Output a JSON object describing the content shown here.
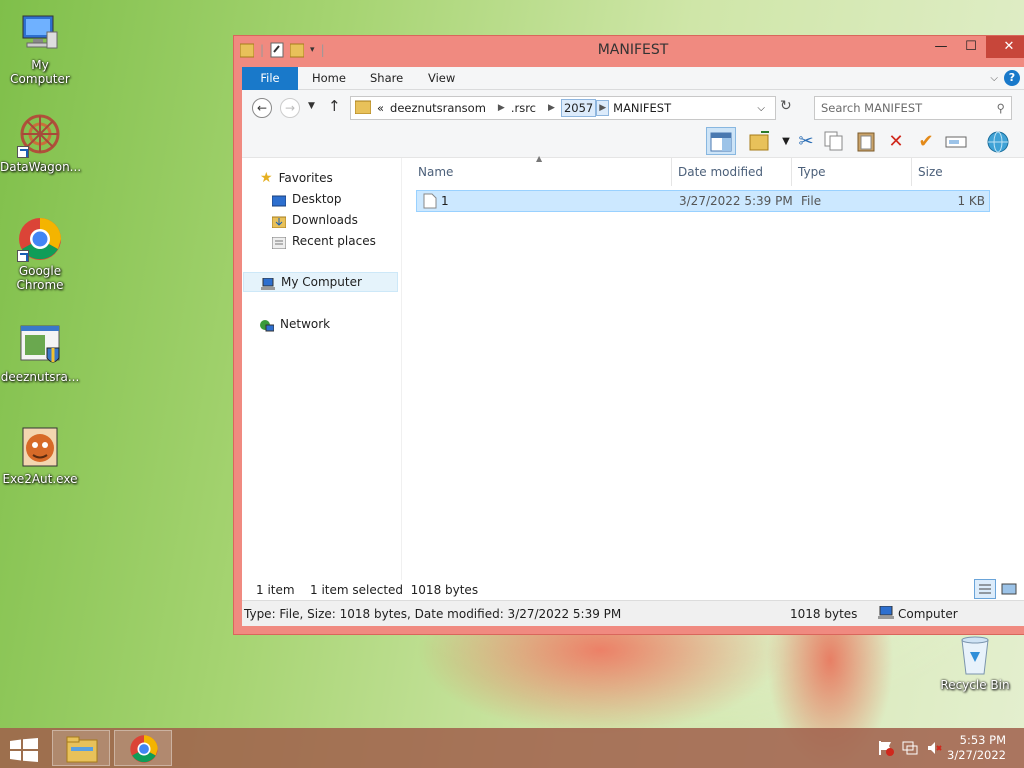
{
  "desktop": {
    "icons": [
      {
        "label": "My Computer"
      },
      {
        "label": "DataWagon..."
      },
      {
        "label": "Google Chrome"
      },
      {
        "label": "deeznutsra..."
      },
      {
        "label": "Exe2Aut.exe"
      },
      {
        "label": "Recycle Bin"
      }
    ]
  },
  "window": {
    "title": "MANIFEST",
    "ribbon_tabs": [
      "File",
      "Home",
      "Share",
      "View"
    ],
    "address": {
      "prefix": "«",
      "segments": [
        "deeznutsransom",
        ".rsrc",
        "2057",
        "MANIFEST"
      ]
    },
    "search_placeholder": "Search MANIFEST",
    "nav": {
      "favorites": "Favorites",
      "desktop": "Desktop",
      "downloads": "Downloads",
      "recent": "Recent places",
      "computer": "My Computer",
      "network": "Network"
    },
    "columns": [
      "Name",
      "Date modified",
      "Type",
      "Size"
    ],
    "files": [
      {
        "name": "1",
        "date": "3/27/2022 5:39 PM",
        "type": "File",
        "size": "1 KB"
      }
    ],
    "status": {
      "count": "1 item",
      "selected": "1 item selected  1018 bytes"
    },
    "details": {
      "info": "Type: File, Size: 1018 bytes, Date modified: 3/27/2022 5:39 PM",
      "size": "1018 bytes",
      "location": "Computer"
    }
  },
  "taskbar": {
    "time": "5:53 PM",
    "date": "3/27/2022"
  },
  "colors": {
    "accent": "#1979ca",
    "window_frame": "#f08a80",
    "close_button": "#c7463a",
    "selection": "#cce8ff"
  }
}
